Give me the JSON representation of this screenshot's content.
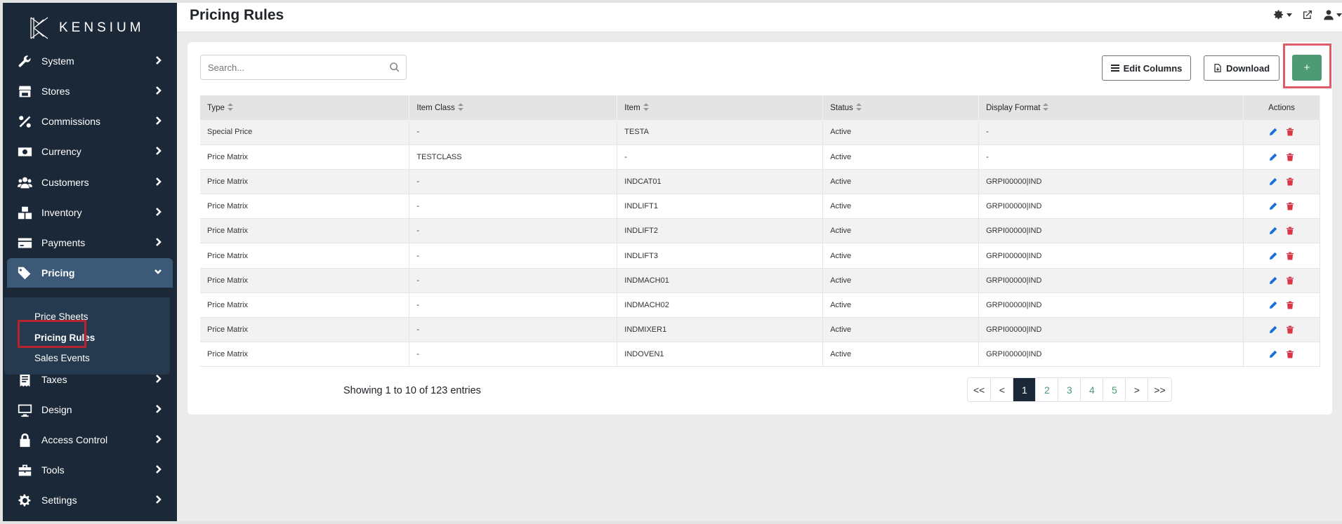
{
  "brand": {
    "name": "KENSIUM"
  },
  "colors": {
    "sidebar": "#1b2838",
    "accent": "#4d9a74",
    "active_nav": "#3c5a77",
    "delete": "#dc3545",
    "edit": "#1a6fd8"
  },
  "sidebar": {
    "items": [
      {
        "label": "System",
        "icon": "wrench-icon"
      },
      {
        "label": "Stores",
        "icon": "store-icon"
      },
      {
        "label": "Commissions",
        "icon": "percent-icon"
      },
      {
        "label": "Currency",
        "icon": "money-bill-icon"
      },
      {
        "label": "Customers",
        "icon": "users-icon"
      },
      {
        "label": "Inventory",
        "icon": "boxes-icon"
      },
      {
        "label": "Payments",
        "icon": "credit-card-icon"
      },
      {
        "label": "Pricing",
        "icon": "tags-icon",
        "expanded": true
      },
      {
        "label": "Taxes",
        "icon": "receipt-icon"
      },
      {
        "label": "Design",
        "icon": "desktop-icon"
      },
      {
        "label": "Access Control",
        "icon": "lock-icon"
      },
      {
        "label": "Tools",
        "icon": "toolbox-icon"
      },
      {
        "label": "Settings",
        "icon": "gear-icon"
      }
    ],
    "pricing_sub": [
      {
        "label": "Price Sheets"
      },
      {
        "label": "Pricing Rules",
        "current": true
      },
      {
        "label": "Sales Events"
      }
    ]
  },
  "header": {
    "title": "Pricing Rules"
  },
  "toolbar": {
    "search_placeholder": "Search...",
    "edit_columns": "Edit Columns",
    "download": "Download",
    "add": "+"
  },
  "table": {
    "columns": [
      "Type",
      "Item Class",
      "Item",
      "Status",
      "Display Format",
      "Actions"
    ],
    "rows": [
      [
        "Special Price",
        "-",
        "TESTA",
        "Active",
        "-"
      ],
      [
        "Price Matrix",
        "TESTCLASS",
        "-",
        "Active",
        "-"
      ],
      [
        "Price Matrix",
        "-",
        "INDCAT01",
        "Active",
        "GRPI00000|IND"
      ],
      [
        "Price Matrix",
        "-",
        "INDLIFT1",
        "Active",
        "GRPI00000|IND"
      ],
      [
        "Price Matrix",
        "-",
        "INDLIFT2",
        "Active",
        "GRPI00000|IND"
      ],
      [
        "Price Matrix",
        "-",
        "INDLIFT3",
        "Active",
        "GRPI00000|IND"
      ],
      [
        "Price Matrix",
        "-",
        "INDMACH01",
        "Active",
        "GRPI00000|IND"
      ],
      [
        "Price Matrix",
        "-",
        "INDMACH02",
        "Active",
        "GRPI00000|IND"
      ],
      [
        "Price Matrix",
        "-",
        "INDMIXER1",
        "Active",
        "GRPI00000|IND"
      ],
      [
        "Price Matrix",
        "-",
        "INDOVEN1",
        "Active",
        "GRPI00000|IND"
      ]
    ]
  },
  "footer": {
    "showing": "Showing 1 to 10 of 123 entries",
    "pages": [
      "<<",
      "<",
      "1",
      "2",
      "3",
      "4",
      "5",
      ">",
      ">>"
    ],
    "current_page": "1"
  }
}
